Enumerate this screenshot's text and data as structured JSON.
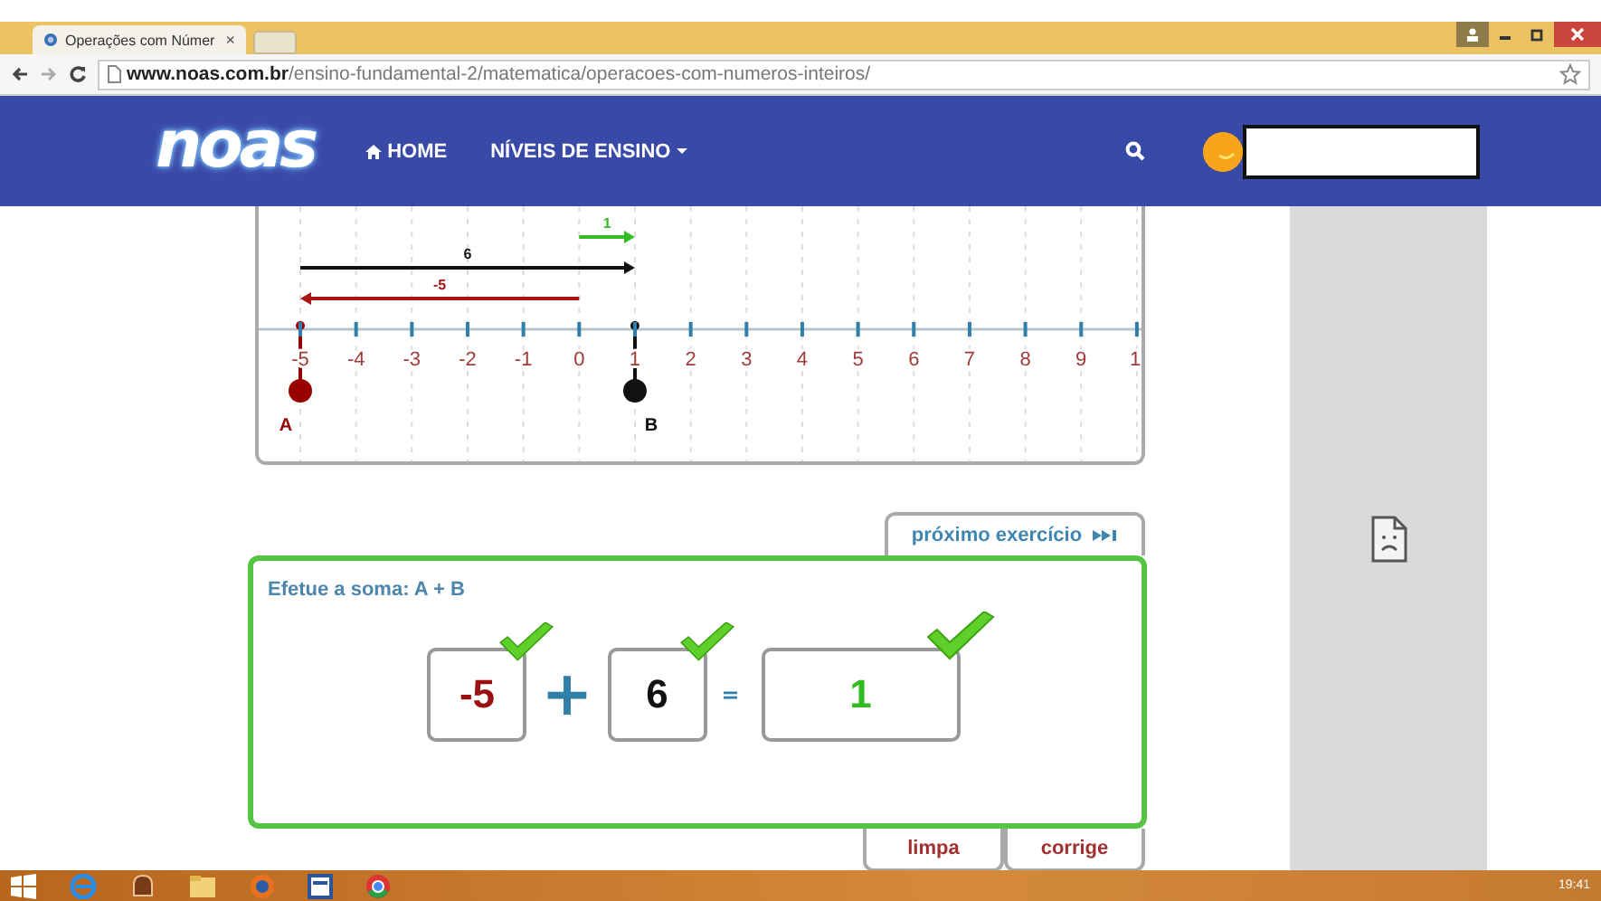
{
  "browser": {
    "tab_title": "Operações com Númer",
    "tab_close": "×",
    "url_host": "www.noas.com.br",
    "url_path": "/ensino-fundamental-2/matematica/operacoes-com-numeros-inteiros/"
  },
  "nav": {
    "logo": "noas",
    "items": [
      {
        "label": "HOME",
        "kind": "home"
      },
      {
        "label": "NÍVEIS DE ENSINO",
        "kind": "dropdown"
      }
    ]
  },
  "number_line": {
    "ticks": [
      "-5",
      "-4",
      "-3",
      "-2",
      "-1",
      "0",
      "1",
      "2",
      "3",
      "4",
      "5",
      "6",
      "7",
      "8",
      "9",
      "1"
    ],
    "arrows": [
      {
        "label": "1",
        "color": "#33bb22"
      },
      {
        "label": "6",
        "color": "#111111"
      },
      {
        "label": "-5",
        "color": "#aa1515"
      }
    ],
    "points": [
      {
        "label": "A",
        "color": "#990000"
      },
      {
        "label": "B",
        "color": "#111111"
      }
    ]
  },
  "exercise": {
    "next_button": "próximo exercício",
    "prompt": "Efetue a soma: A + B",
    "terms": [
      {
        "kind": "number",
        "value": "-5",
        "color": "#9b1010",
        "correct": true
      },
      {
        "kind": "operator",
        "value": "+"
      },
      {
        "kind": "number",
        "value": "6",
        "color": "#111111",
        "correct": true
      },
      {
        "kind": "operator",
        "value": "="
      },
      {
        "kind": "answer",
        "value": "1",
        "color": "#33bb22",
        "correct": true
      }
    ],
    "buttons": [
      "limpa",
      "corrige"
    ]
  },
  "taskbar": {
    "clock": "19:41"
  }
}
